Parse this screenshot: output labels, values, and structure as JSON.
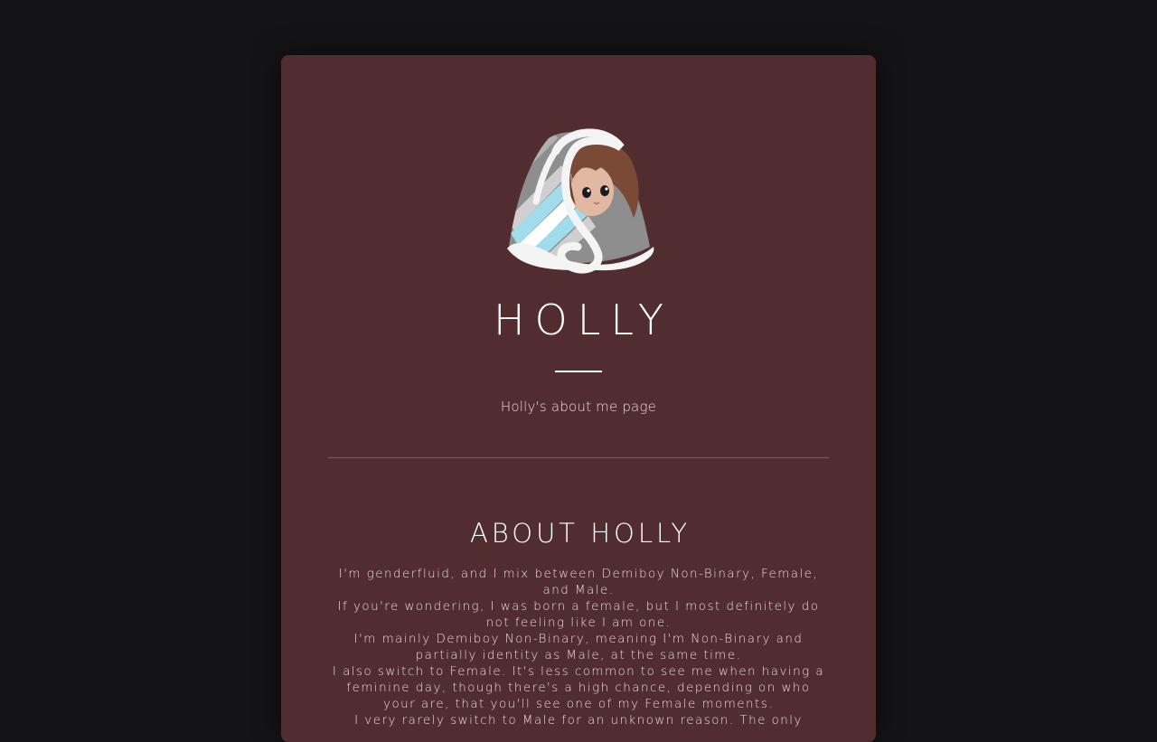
{
  "profile": {
    "name": "HOLLY",
    "subtitle": "Holly's about me page",
    "avatar_icon": "hooded-character-avatar-icon"
  },
  "about": {
    "heading": "ABOUT HOLLY",
    "paragraphs": [
      "I'm genderfluid, and I mix between Demiboy Non-Binary, Female, and Male.",
      "If you're wondering, I was born a female, but I most definitely do not feeling like I am one.",
      "I'm mainly Demiboy Non-Binary, meaning I'm Non-Binary and partially identity as Male, at the same time.",
      "I also switch to Female. It's less common to see me when having a feminine day, though there's a high chance, depending on who your are, that you'll see one of my Female moments.",
      "I very rarely switch to Male for an unknown reason. The only"
    ]
  },
  "colors": {
    "page_background": "#141416",
    "card_background": "#522d2f",
    "text_primary": "#ffffff",
    "text_secondary": "#e8dede",
    "divider": "#7d5c5d"
  }
}
